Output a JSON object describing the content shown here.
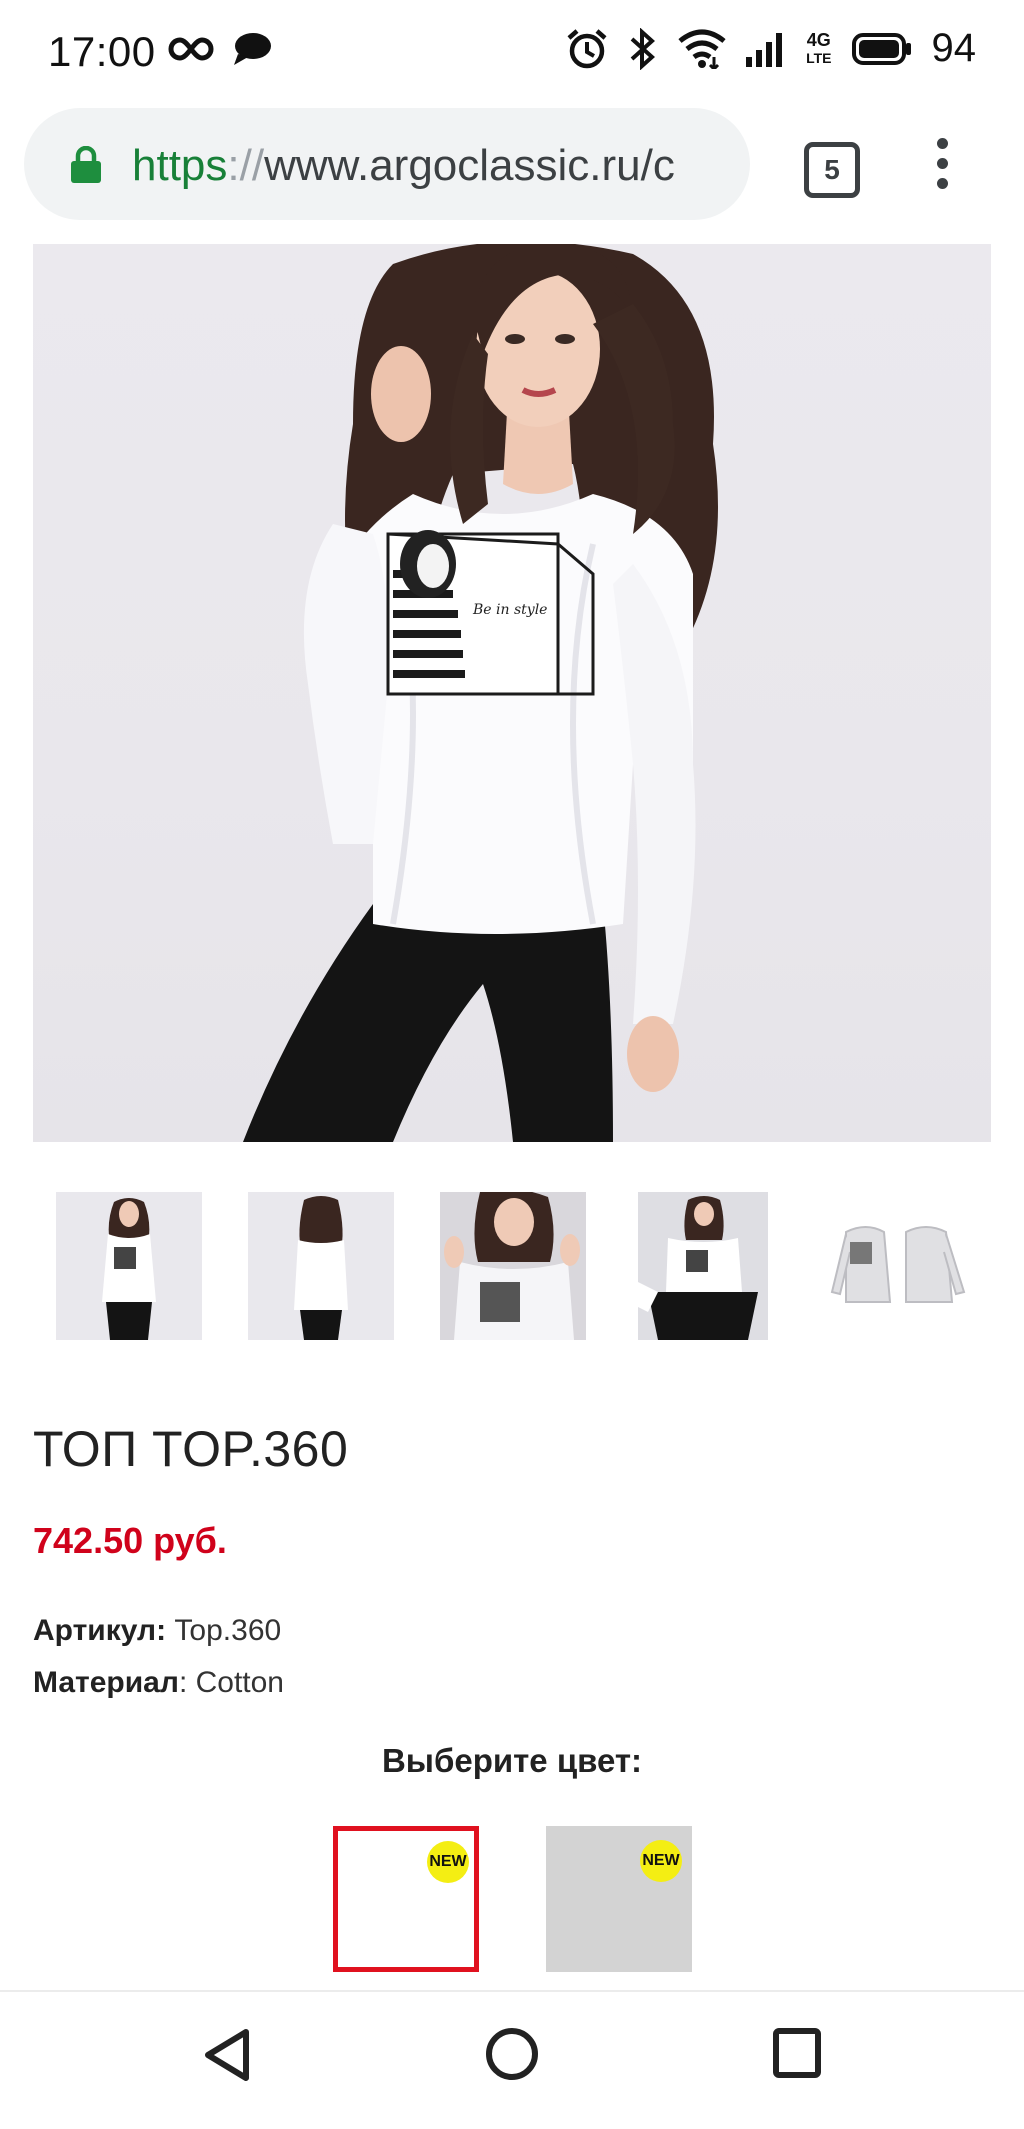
{
  "status_bar": {
    "time": "17:00",
    "battery": "94",
    "icons": [
      "infinity-icon",
      "chat-bubble-icon",
      "alarm-icon",
      "bluetooth-icon",
      "wifi-icon",
      "signal-icon",
      "4g-lte-icon",
      "battery-icon"
    ],
    "network_label_top": "4G",
    "network_label_bottom": "LTE"
  },
  "browser": {
    "url_scheme": "https",
    "url_sep": "://",
    "url_rest": "www.argoclassic.ru/c",
    "tab_count": "5",
    "lock_color": "#1e8e3e"
  },
  "product": {
    "title": "ТОП TOP.360",
    "price": "742.50 руб.",
    "article_label": "Артикул:",
    "article_value": " Top.360",
    "material_label": "Материал",
    "material_value": ": Cotton",
    "color_heading": "Выберите цвет:",
    "print_text": "Be in style",
    "swatches": [
      {
        "color": "white",
        "badge": "NEW",
        "selected": true
      },
      {
        "color": "grey",
        "badge": "NEW",
        "selected": false
      }
    ],
    "thumbnails": [
      "front-view",
      "back-view",
      "closeup-view",
      "seated-view",
      "flat-lay-view"
    ]
  },
  "colors": {
    "price_red": "#d0021b",
    "selected_border": "#e0111f",
    "badge_yellow": "#f4ee13"
  }
}
